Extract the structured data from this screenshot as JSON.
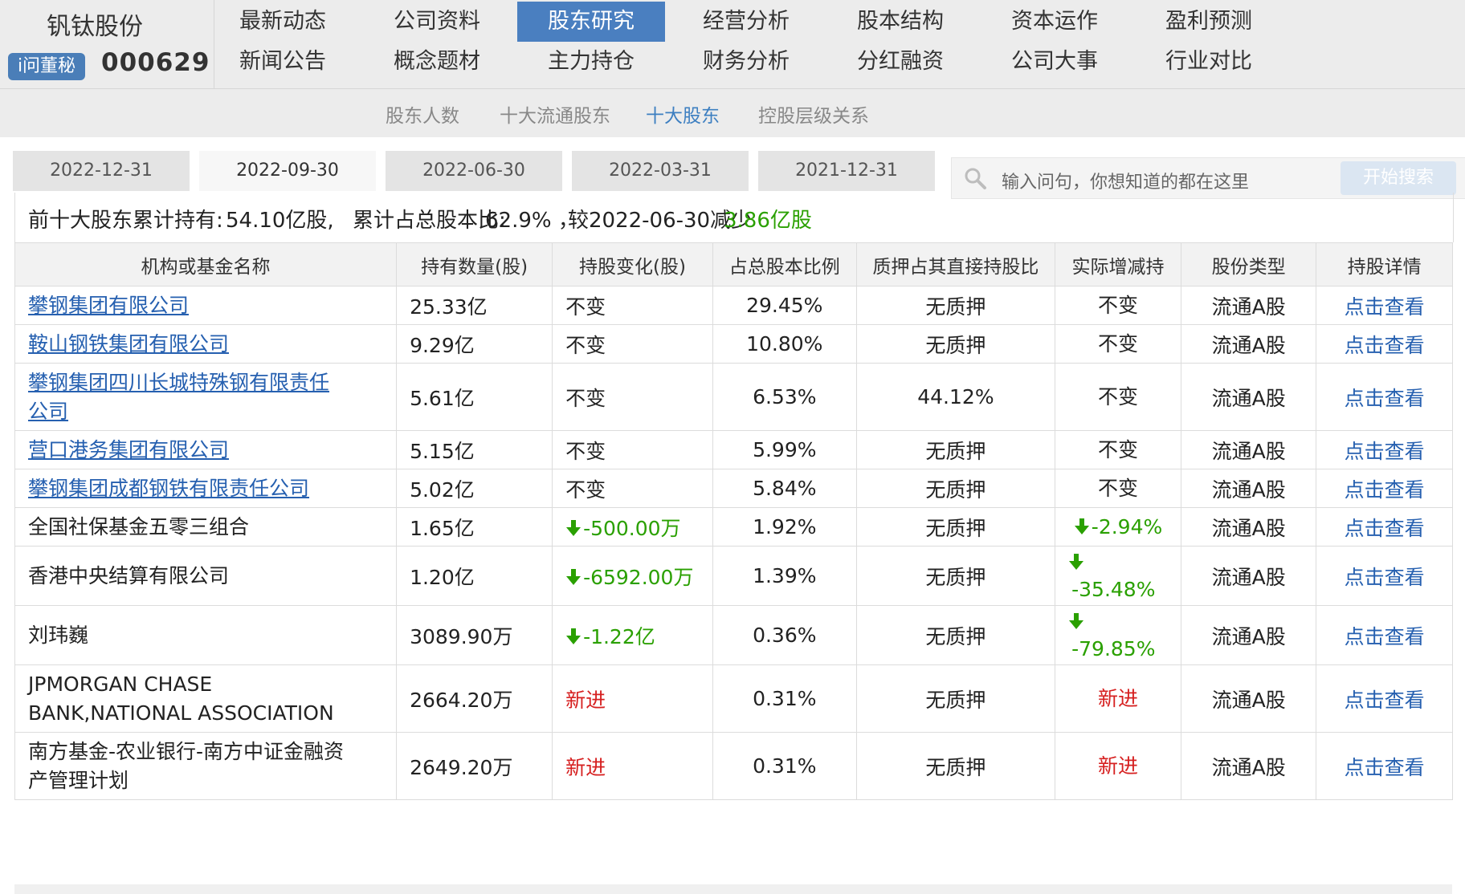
{
  "header": {
    "company_name": "钒钛股份",
    "badge": "i问董秘",
    "stock_code": "000629"
  },
  "nav": {
    "row1": [
      "最新动态",
      "公司资料",
      "股东研究",
      "经营分析",
      "股本结构",
      "资本运作",
      "盈利预测"
    ],
    "row2": [
      "新闻公告",
      "概念题材",
      "主力持仓",
      "财务分析",
      "分红融资",
      "公司大事",
      "行业对比"
    ],
    "active": "股东研究"
  },
  "subnav": {
    "items": [
      "股东人数",
      "十大流通股东",
      "十大股东",
      "控股层级关系"
    ],
    "active": "十大股东"
  },
  "date_tabs": [
    "2022-12-31",
    "2022-09-30",
    "2022-06-30",
    "2022-03-31",
    "2021-12-31"
  ],
  "active_date": "2022-09-30",
  "search": {
    "placeholder": "输入问句，你想知道的都在这里",
    "button": "开始搜索"
  },
  "summary": {
    "label": "前十大股东累计持有:",
    "amount": "54.10亿股,",
    "ratio_label": "累计占总股本比:",
    "ratio": "62.9% ，",
    "compare": "较2022-06-30减少",
    "change": "3.86亿股"
  },
  "table": {
    "headers": [
      "机构或基金名称",
      "持有数量(股)",
      "持股变化(股)",
      "占总股本比例",
      "质押占其直接持股比",
      "实际增减持",
      "股份类型",
      "持股详情"
    ],
    "rows": [
      {
        "name": [
          "攀钢集团有限公司"
        ],
        "linked": true,
        "qty": "25.33亿",
        "change": "不变",
        "change_type": "same",
        "ratio": "29.45%",
        "pledge": "无质押",
        "actual": [
          "不变"
        ],
        "actual_type": "same",
        "type": "流通A股",
        "detail": "点击查看"
      },
      {
        "name": [
          "鞍山钢铁集团有限公司"
        ],
        "linked": true,
        "qty": "9.29亿",
        "change": "不变",
        "change_type": "same",
        "ratio": "10.80%",
        "pledge": "无质押",
        "actual": [
          "不变"
        ],
        "actual_type": "same",
        "type": "流通A股",
        "detail": "点击查看"
      },
      {
        "name": [
          "攀钢集团四川长城特殊钢有限责任",
          "公司"
        ],
        "linked": true,
        "qty": "5.61亿",
        "change": "不变",
        "change_type": "same",
        "ratio": "6.53%",
        "pledge": "44.12%",
        "actual": [
          "不变"
        ],
        "actual_type": "same",
        "type": "流通A股",
        "detail": "点击查看"
      },
      {
        "name": [
          "营口港务集团有限公司"
        ],
        "linked": true,
        "qty": "5.15亿",
        "change": "不变",
        "change_type": "same",
        "ratio": "5.99%",
        "pledge": "无质押",
        "actual": [
          "不变"
        ],
        "actual_type": "same",
        "type": "流通A股",
        "detail": "点击查看"
      },
      {
        "name": [
          "攀钢集团成都钢铁有限责任公司"
        ],
        "linked": true,
        "qty": "5.02亿",
        "change": "不变",
        "change_type": "same",
        "ratio": "5.84%",
        "pledge": "无质押",
        "actual": [
          "不变"
        ],
        "actual_type": "same",
        "type": "流通A股",
        "detail": "点击查看"
      },
      {
        "name": [
          "全国社保基金五零三组合"
        ],
        "linked": false,
        "qty": "1.65亿",
        "change": "-500.00万",
        "change_type": "down",
        "ratio": "1.92%",
        "pledge": "无质押",
        "actual": [
          "-2.94%"
        ],
        "actual_type": "down",
        "type": "流通A股",
        "detail": "点击查看"
      },
      {
        "name": [
          "香港中央结算有限公司"
        ],
        "linked": false,
        "qty": "1.20亿",
        "change": "-6592.00万",
        "change_type": "down",
        "ratio": "1.39%",
        "pledge": "无质押",
        "actual": [
          "-35.48%"
        ],
        "actual_type": "down-wrap",
        "type": "流通A股",
        "detail": "点击查看"
      },
      {
        "name": [
          "刘玮巍"
        ],
        "linked": false,
        "qty": "3089.90万",
        "change": "-1.22亿",
        "change_type": "down",
        "ratio": "0.36%",
        "pledge": "无质押",
        "actual": [
          "-79.85%"
        ],
        "actual_type": "down-wrap",
        "type": "流通A股",
        "detail": "点击查看"
      },
      {
        "name": [
          "JPMORGAN CHASE",
          "BANK,NATIONAL ASSOCIATION"
        ],
        "linked": false,
        "qty": "2664.20万",
        "change": "新进",
        "change_type": "new",
        "ratio": "0.31%",
        "pledge": "无质押",
        "actual": [
          "新进"
        ],
        "actual_type": "new",
        "type": "流通A股",
        "detail": "点击查看"
      },
      {
        "name": [
          "南方基金-农业银行-南方中证金融资",
          "产管理计划"
        ],
        "linked": false,
        "qty": "2649.20万",
        "change": "新进",
        "change_type": "new",
        "ratio": "0.31%",
        "pledge": "无质押",
        "actual": [
          "新进"
        ],
        "actual_type": "new",
        "type": "流通A股",
        "detail": "点击查看"
      }
    ]
  },
  "colors": {
    "nav_active": "#4a7fc0",
    "link": "#2660b0",
    "decrease": "#2aa000",
    "new": "#d62020"
  }
}
